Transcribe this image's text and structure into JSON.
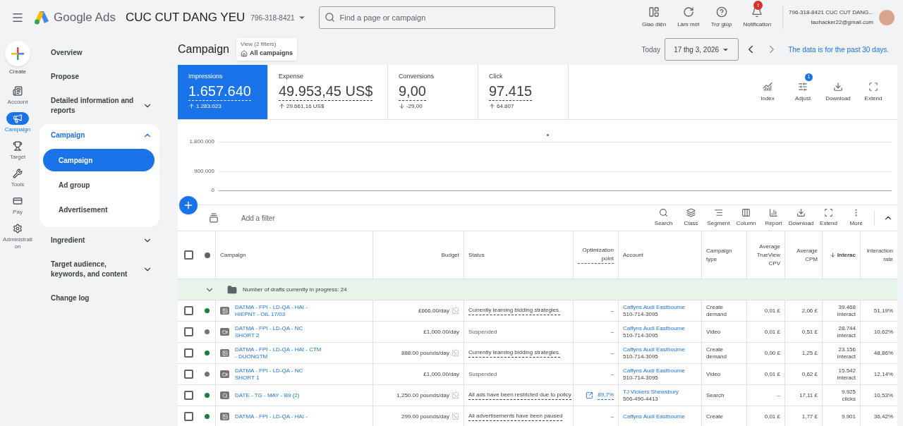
{
  "topbar": {
    "product": "Google Ads",
    "account_name": "CUC CUT DANG YEU",
    "account_id": "796-318-8421",
    "search": {
      "placeholder": "Find a page or campaign"
    },
    "actions": [
      {
        "label": "Giao diện"
      },
      {
        "label": "Làm mới"
      },
      {
        "label": "Trợ giúp"
      },
      {
        "label": "Notification",
        "badge": "!"
      }
    ],
    "user": {
      "line1": "796-318-8421 CUC CUT DANG...",
      "email": "taohacker22@gmail.com"
    }
  },
  "rail": [
    {
      "label": "Create",
      "selected": false
    },
    {
      "label": "Account",
      "selected": false
    },
    {
      "label": "Campaign",
      "selected": true
    },
    {
      "label": "Target",
      "selected": false
    },
    {
      "label": "Tools",
      "selected": false
    },
    {
      "label": "Pay",
      "selected": false
    },
    {
      "label": "Administration",
      "selected": false
    }
  ],
  "nav": [
    {
      "label": "Overview"
    },
    {
      "label": "Propose"
    },
    {
      "label": "Detailed information and reports",
      "expanded": false
    },
    {
      "label": "Campaign",
      "expanded": true,
      "children": [
        {
          "label": "Campaign",
          "selected": true
        },
        {
          "label": "Ad group",
          "selected": false
        },
        {
          "label": "Advertisement",
          "selected": false
        }
      ]
    },
    {
      "label": "Ingredient",
      "expanded": false
    },
    {
      "label": "Target audience, keywords, and content",
      "expanded": false
    },
    {
      "label": "Change log"
    }
  ],
  "page": {
    "title": "Campaign",
    "view": {
      "caption": "View (2 filters)",
      "label": "All campaigns"
    },
    "date_prefix": "Today",
    "date": "17 thg 3, 2026",
    "note": "The data is for the past 30 days."
  },
  "metrics": [
    {
      "label": "Impressions",
      "value": "1.657.640",
      "delta": "1.283.023",
      "rising": true,
      "selected": true
    },
    {
      "label": "Expense",
      "value": "49.953,45 US$",
      "delta": "29.661,16 US$",
      "rising": true,
      "selected": false
    },
    {
      "label": "Conversions",
      "value": "9,00",
      "delta": "-29,00",
      "rising": false,
      "selected": false
    },
    {
      "label": "Click",
      "value": "97.415",
      "delta": "64.807",
      "rising": true,
      "selected": false
    }
  ],
  "chart_tools": [
    {
      "label": "Index"
    },
    {
      "label": "Adjust",
      "badge": "1"
    },
    {
      "label": "Download"
    },
    {
      "label": "Extend"
    }
  ],
  "chart": {
    "axis_labels": [
      "1.800.000",
      "900.000",
      "0"
    ]
  },
  "table_toolbar": {
    "filter_placeholder": "Add a filter",
    "tools": [
      {
        "label": "Search"
      },
      {
        "label": "Class"
      },
      {
        "label": "Segment"
      },
      {
        "label": "Column"
      },
      {
        "label": "Report"
      },
      {
        "label": "Download"
      },
      {
        "label": "Extend"
      },
      {
        "label": "More"
      }
    ]
  },
  "table": {
    "header_checked": false,
    "columns": [
      {
        "label": "Campaign"
      },
      {
        "label": "Budget"
      },
      {
        "label": "Status"
      },
      {
        "label": "Optimization point"
      },
      {
        "label": "Account"
      },
      {
        "label": "Campaign type"
      },
      {
        "label": "Average TrueView CPV"
      },
      {
        "label": "Average CPM"
      },
      {
        "label": "Interac",
        "sorted": true
      },
      {
        "label": "Interaction rate"
      }
    ],
    "group_row": {
      "label": "Number of drafts currently in progress: 24",
      "expanded": true
    },
    "rows": [
      {
        "checked": false,
        "color": "#188038",
        "kind": "display",
        "name": "DATMA - FPI - LD-QA - HAI - HIEPNT - OIL 17/03",
        "budget": "£666.00/day",
        "budget_chart": true,
        "status": "Currently learning bidding strategies.",
        "status_detail": true,
        "opt": "–",
        "opt_link": false,
        "account": "Caffyns Audi Eastbourne",
        "account_id": "510-714-3095",
        "type": "Create demand",
        "cpv": "0,01 £",
        "cpm": "2,06 £",
        "interactions": "39.468",
        "interactions_unit": "interact",
        "rate": "51,19%"
      },
      {
        "checked": false,
        "color": "#757575",
        "kind": "video",
        "name": "DATMA - FPI - LD-QA - NC SHORT 2",
        "budget": "£1,000.00/day",
        "budget_chart": false,
        "status": "Suspended",
        "status_detail": false,
        "opt": "–",
        "opt_link": false,
        "account": "Caffyns Audi Eastbourne",
        "account_id": "510-714-3095",
        "type": "Video",
        "cpv": "0,01 £",
        "cpm": "0,51 £",
        "interactions": "28.744",
        "interactions_unit": "interact",
        "rate": "10,62%"
      },
      {
        "checked": false,
        "color": "#188038",
        "kind": "display",
        "name": "DATMA - FPI - LD-QA - HAI - CTM - DUONGTM",
        "budget": "888.00 pounds/day",
        "budget_chart": true,
        "status": "Currently learning bidding strategies.",
        "status_detail": true,
        "opt": "–",
        "opt_link": false,
        "account": "Caffyns Audi Eastbourne",
        "account_id": "510-714-3095",
        "type": "Create demand",
        "cpv": "0,00 £",
        "cpm": "1,25 £",
        "interactions": "23.156",
        "interactions_unit": "interact",
        "rate": "48,86%"
      },
      {
        "checked": false,
        "color": "#757575",
        "kind": "video",
        "name": "DATMA - FPI - LD-QA - NC SHORT 1",
        "budget": "£1,000.00/day",
        "budget_chart": false,
        "status": "Suspended",
        "status_detail": false,
        "opt": "–",
        "opt_link": false,
        "account": "Caffyns Audi Eastbourne",
        "account_id": "510-714-3095",
        "type": "Video",
        "cpv": "0,01 £",
        "cpm": "0,62 £",
        "interactions": "15.542",
        "interactions_unit": "interact",
        "rate": "12,14%"
      },
      {
        "checked": false,
        "color": "#188038",
        "kind": "search",
        "name": "DATE - TG - MAY - B9 (2)",
        "budget": "1,250.00 pounds/day",
        "budget_chart": true,
        "status": "All ads have been restricted due to policy",
        "status_detail": true,
        "opt": "89,7%",
        "opt_link": true,
        "account": "TJ Vickers Shewsbury",
        "account_id": "506-490-4413",
        "type": "Search",
        "cpv": "–",
        "cpm": "17,11 £",
        "interactions": "9.925",
        "interactions_unit": "clicks",
        "rate": "10,53%"
      },
      {
        "checked": false,
        "color": "#188038",
        "kind": "display",
        "name": "DATMA - FPI - LD-QA - HAI -",
        "budget": "299.00 pounds/day",
        "budget_chart": true,
        "status": "All advertisements have been paused",
        "status_detail": true,
        "opt": "–",
        "opt_link": false,
        "account": "Caffyns Audi Eastbourne",
        "type": "Create",
        "cpv": "0,01 £",
        "cpm": "1,77 £",
        "interactions": "9.901",
        "rate": "36,42%"
      }
    ]
  }
}
